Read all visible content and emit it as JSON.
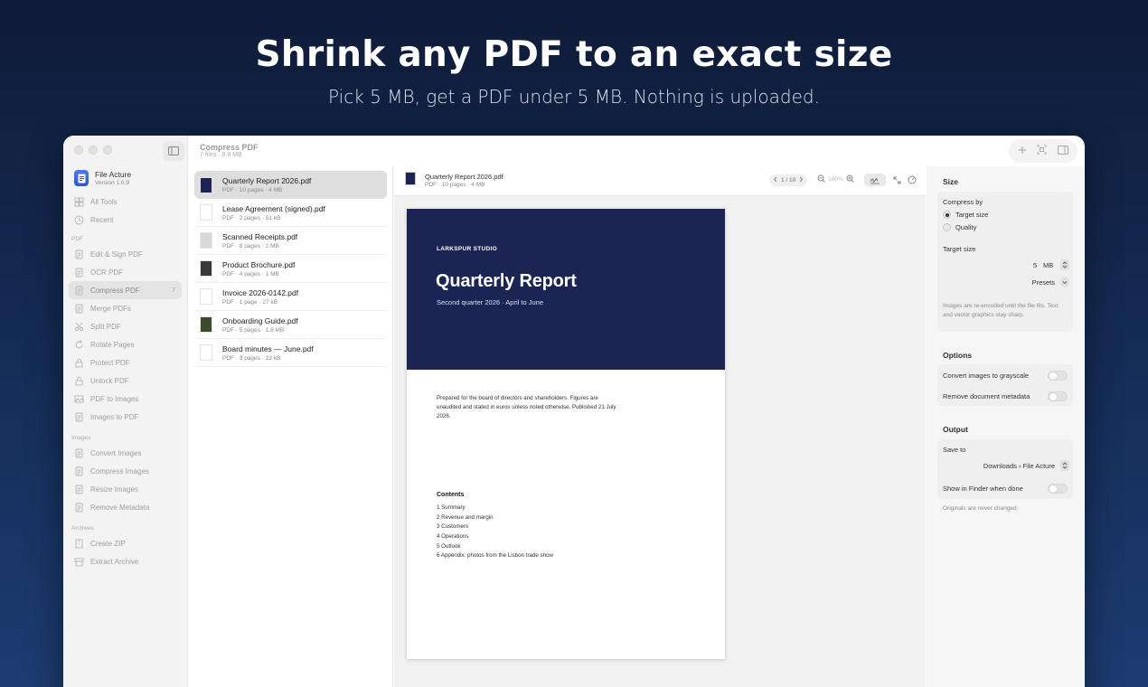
{
  "hero": {
    "title": "Shrink any PDF to an exact size",
    "subtitle": "Pick 5 MB, get a PDF under 5 MB. Nothing is uploaded."
  },
  "window": {
    "title": "Compress PDF",
    "subtitle": "7 files · 8.8 MB"
  },
  "app": {
    "name": "File Acture",
    "version": "Version 1.0.9"
  },
  "sidebar": {
    "top_items": [
      {
        "label": "All Tools",
        "icon": "grid-icon"
      },
      {
        "label": "Recent",
        "icon": "clock-icon"
      }
    ],
    "sections": [
      {
        "title": "PDF",
        "items": [
          {
            "label": "Edit & Sign PDF",
            "icon": "signature-icon"
          },
          {
            "label": "OCR PDF",
            "icon": "scan-text-icon"
          },
          {
            "label": "Compress PDF",
            "icon": "compress-icon",
            "badge": "7",
            "active": true
          },
          {
            "label": "Merge PDFs",
            "icon": "merge-icon"
          },
          {
            "label": "Split PDF",
            "icon": "scissors-icon"
          },
          {
            "label": "Rotate Pages",
            "icon": "rotate-icon"
          },
          {
            "label": "Protect PDF",
            "icon": "lock-icon"
          },
          {
            "label": "Unlock PDF",
            "icon": "unlock-icon"
          },
          {
            "label": "PDF to Images",
            "icon": "image-icon"
          },
          {
            "label": "Images to PDF",
            "icon": "document-icon"
          }
        ]
      },
      {
        "title": "Images",
        "items": [
          {
            "label": "Convert Images",
            "icon": "convert-icon"
          },
          {
            "label": "Compress Images",
            "icon": "compress-image-icon"
          },
          {
            "label": "Resize Images",
            "icon": "resize-icon"
          },
          {
            "label": "Remove Metadata",
            "icon": "eraser-icon"
          }
        ]
      },
      {
        "title": "Archives",
        "items": [
          {
            "label": "Create ZIP",
            "icon": "zip-icon"
          },
          {
            "label": "Extract Archive",
            "icon": "archive-icon"
          }
        ]
      }
    ]
  },
  "files": [
    {
      "name": "Quarterly Report 2026.pdf",
      "meta": "PDF · 10 pages · 4 MB",
      "selected": true,
      "thumb": "#1b2452"
    },
    {
      "name": "Lease Agreement (signed).pdf",
      "meta": "PDF · 2 pages · 51 kB",
      "thumb": "#ffffff"
    },
    {
      "name": "Scanned Receipts.pdf",
      "meta": "PDF · 8 pages · 2 MB",
      "thumb": "#d9d9d9"
    },
    {
      "name": "Product Brochure.pdf",
      "meta": "PDF · 4 pages · 1 MB",
      "thumb": "#3a3a3a"
    },
    {
      "name": "Invoice 2026-0142.pdf",
      "meta": "PDF · 1 page · 27 kB",
      "thumb": "#ffffff"
    },
    {
      "name": "Onboarding Guide.pdf",
      "meta": "PDF · 5 pages · 1.8 MB",
      "thumb": "#3d4a2e"
    },
    {
      "name": "Board minutes — June.pdf",
      "meta": "PDF · 3 pages · 23 kB",
      "thumb": "#ffffff"
    }
  ],
  "preview": {
    "file_name": "Quarterly Report 2026.pdf",
    "file_meta": "PDF · 10 pages · 4 MB",
    "page_indicator": "1 / 10",
    "zoom": "100%",
    "document": {
      "studio": "LARKSPUR STUDIO",
      "title": "Quarterly Report",
      "subtitle": "Second quarter 2026 · April to June",
      "intro": "Prepared for the board of directors and shareholders. Figures are unaudited and stated in euros unless noted otherwise. Published 21 July 2026.",
      "contents_title": "Contents",
      "contents": [
        "1  Summary",
        "2  Revenue and margin",
        "3  Customers",
        "4  Operations",
        "5  Outlook",
        "6  Appendix: photos from the Lisbon trade show"
      ]
    }
  },
  "inspector": {
    "size": {
      "heading": "Size",
      "compress_by_label": "Compress by",
      "option_target": "Target size",
      "option_quality": "Quality",
      "selected": "Target size",
      "target_size_label": "Target size",
      "target_value": "5",
      "target_unit": "MB",
      "presets_label": "Presets",
      "note": "Images are re-encoded until the file fits. Text and vector graphics stay sharp."
    },
    "options": {
      "heading": "Options",
      "grayscale_label": "Convert images to grayscale",
      "metadata_label": "Remove document metadata"
    },
    "output": {
      "heading": "Output",
      "save_to_label": "Save to",
      "save_to_value": "Downloads › File Acture",
      "finder_label": "Show in Finder when done",
      "note": "Originals are never changed."
    }
  }
}
